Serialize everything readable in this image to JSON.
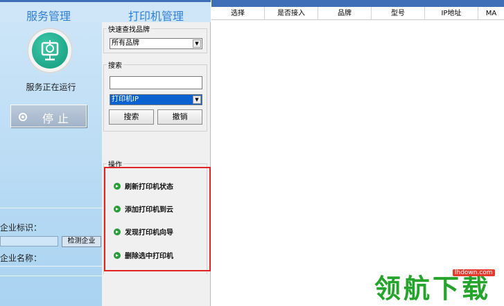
{
  "left_panel": {
    "title": "服务管理",
    "service_status": "服务正在运行",
    "stop_button": "停止",
    "enterprise_id_label": "企业标识：",
    "detect_enterprise_button": "检测企业",
    "enterprise_name_label": "企业名称："
  },
  "middle_panel": {
    "title": "打印机管理",
    "brand_group_title": "快速查找品牌",
    "brand_select_value": "所有品牌",
    "search_group_title": "搜索",
    "search_input_value": "",
    "search_field_select_value": "打印机IP",
    "search_button": "搜索",
    "cancel_button": "撤销",
    "ops_group_title": "操作",
    "operations": [
      "刷新打印机状态",
      "添加打印机到云",
      "发现打印机向导",
      "删除选中打印机"
    ]
  },
  "table": {
    "columns": [
      "选择",
      "是否接入",
      "品牌",
      "型号",
      "IP地址",
      "MA"
    ]
  },
  "watermark": {
    "text": "领航下载",
    "url": "lhdown.com"
  },
  "colors": {
    "header_blue": "#2f7ed6",
    "panel_blue": "#a9d3f1",
    "ops_highlight": "#e32222",
    "op_icon_green": "#2b9c3a"
  }
}
